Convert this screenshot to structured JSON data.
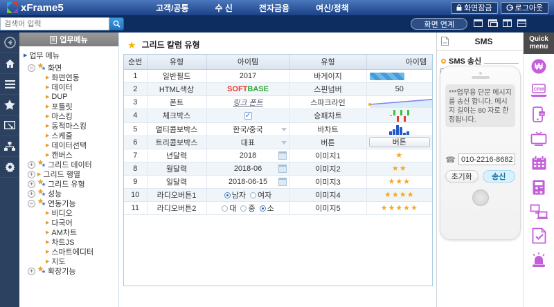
{
  "colors": {
    "topbar_blue": "#1c4186",
    "subbar_navy": "#0d2c5f",
    "rail_navy": "#2c415f",
    "accent_orange": "#f5a623",
    "quick_purple": "#c35fd9",
    "softbase_red": "#e8372f",
    "softbase_green": "#2fa832",
    "bar_blue": "#2458c8"
  },
  "topbar": {
    "logo_text": "xFrame5",
    "menu_items": [
      "고객/공통",
      "수 신",
      "전자금융",
      "여신/정책"
    ],
    "lock_label": "화면잠금",
    "logout_label": "로그아웃"
  },
  "subbar": {
    "search_placeholder": "검색어 입력",
    "screen_link_label": "화면 연계",
    "window_icons": [
      "window-single",
      "window-cascade",
      "window-tile-vertical",
      "window-tile-horizontal"
    ]
  },
  "left_rail": {
    "icons": [
      "collapse-arrow",
      "home",
      "menu-list",
      "favorites-star",
      "screen-search",
      "sitemap",
      "settings-gear"
    ]
  },
  "menu_panel": {
    "header": "업무메뉴",
    "tree": [
      {
        "label": "업무 메뉴",
        "kind": "root"
      },
      {
        "label": "화면",
        "kind": "open"
      },
      {
        "label": "화면연동",
        "kind": "leaf"
      },
      {
        "label": "데이터",
        "kind": "leaf"
      },
      {
        "label": "DUP",
        "kind": "leaf"
      },
      {
        "label": "포틀릿",
        "kind": "leaf"
      },
      {
        "label": "마스킹",
        "kind": "leaf"
      },
      {
        "label": "동적마스킹",
        "kind": "leaf"
      },
      {
        "label": "스케줄",
        "kind": "leaf"
      },
      {
        "label": "데이터선택",
        "kind": "leaf"
      },
      {
        "label": "캔버스",
        "kind": "leaf"
      },
      {
        "label": "그리드 데이터",
        "kind": "closed"
      },
      {
        "label": "그리드 행열",
        "kind": "closed",
        "icon": "arrow"
      },
      {
        "label": "그리드 유형",
        "kind": "closed"
      },
      {
        "label": "성능",
        "kind": "closed"
      },
      {
        "label": "연동기능",
        "kind": "open"
      },
      {
        "label": "비디오",
        "kind": "leaf"
      },
      {
        "label": "다국어",
        "kind": "leaf"
      },
      {
        "label": "AM차트",
        "kind": "leaf"
      },
      {
        "label": "차트JS",
        "kind": "leaf"
      },
      {
        "label": "스마트에디터",
        "kind": "leaf"
      },
      {
        "label": "지도",
        "kind": "leaf"
      },
      {
        "label": "확장기능",
        "kind": "closed"
      }
    ]
  },
  "content": {
    "title": "그리드 칼럼 유형",
    "table": {
      "columns": [
        "순번",
        "유형",
        "아이템",
        "유형",
        "아이템"
      ],
      "rows": [
        {
          "no": "1",
          "type1": "일반필드",
          "item1": {
            "kind": "text",
            "value": "2017"
          },
          "type2": "바게이지",
          "item2": {
            "kind": "gauge",
            "percent": 55
          }
        },
        {
          "no": "2",
          "type1": "HTML색상",
          "item1": {
            "kind": "htmlcolor",
            "parts": [
              {
                "text": "SOFT",
                "cls": "red"
              },
              {
                "text": "BASE",
                "cls": "green"
              }
            ]
          },
          "type2": "스핀넘버",
          "item2": {
            "kind": "text",
            "value": "50"
          }
        },
        {
          "no": "3",
          "type1": "폰트",
          "item1": {
            "kind": "link",
            "value": "링크 폰트"
          },
          "type2": "스파크라인",
          "item2": {
            "kind": "sparkline"
          }
        },
        {
          "no": "4",
          "type1": "체크박스",
          "item1": {
            "kind": "checkbox",
            "checked": true
          },
          "type2": "승패차트",
          "item2": {
            "kind": "winloss",
            "values": [
              0,
              1,
              -1,
              1,
              -1,
              1
            ]
          }
        },
        {
          "no": "5",
          "type1": "멀티콤보박스",
          "item1": {
            "kind": "combo",
            "value": "한국/중국"
          },
          "type2": "바차트",
          "item2": {
            "kind": "bars",
            "values": [
              5,
              8,
              14,
              11,
              3,
              5
            ]
          }
        },
        {
          "no": "6",
          "type1": "트리콤보박스",
          "item1": {
            "kind": "combo",
            "value": "대표"
          },
          "type2": "버튼",
          "item2": {
            "kind": "button",
            "label": "버튼"
          }
        },
        {
          "no": "7",
          "type1": "년달력",
          "item1": {
            "kind": "date",
            "value": "2018"
          },
          "type2": "이미지1",
          "item2": {
            "kind": "stars",
            "count": 1
          }
        },
        {
          "no": "8",
          "type1": "월달력",
          "item1": {
            "kind": "date",
            "value": "2018-06"
          },
          "type2": "이미지2",
          "item2": {
            "kind": "stars",
            "count": 2
          }
        },
        {
          "no": "9",
          "type1": "일달력",
          "item1": {
            "kind": "date",
            "value": "2018-06-15"
          },
          "type2": "이미지3",
          "item2": {
            "kind": "stars",
            "count": 3
          }
        },
        {
          "no": "10",
          "type1": "라디오버튼1",
          "item1": {
            "kind": "radio",
            "options": [
              {
                "label": "남자",
                "selected": true
              },
              {
                "label": "여자",
                "selected": false
              }
            ]
          },
          "type2": "이미지4",
          "item2": {
            "kind": "stars",
            "count": 4
          }
        },
        {
          "no": "11",
          "type1": "라디오버튼2",
          "item1": {
            "kind": "radio",
            "options": [
              {
                "label": "대",
                "selected": false
              },
              {
                "label": "중",
                "selected": false
              },
              {
                "label": "소",
                "selected": true
              }
            ]
          },
          "type2": "이미지5",
          "item2": {
            "kind": "stars",
            "count": 5
          }
        }
      ]
    }
  },
  "sms_panel": {
    "title": "SMS",
    "section_title": "SMS 송신",
    "message": "***업무용 단문 메시지를 송신 합니다. 메시지 길이는 80 자로 한정됩니다.",
    "phone_number": "010-2216-8682",
    "reset_label": "초기화",
    "send_label": "송신"
  },
  "quick_menu": {
    "label": "Quick menu",
    "icons": [
      "won-currency",
      "crm",
      "sms-phone",
      "tv",
      "calendar",
      "calculator",
      "network-pc",
      "report-check",
      "siren"
    ]
  }
}
